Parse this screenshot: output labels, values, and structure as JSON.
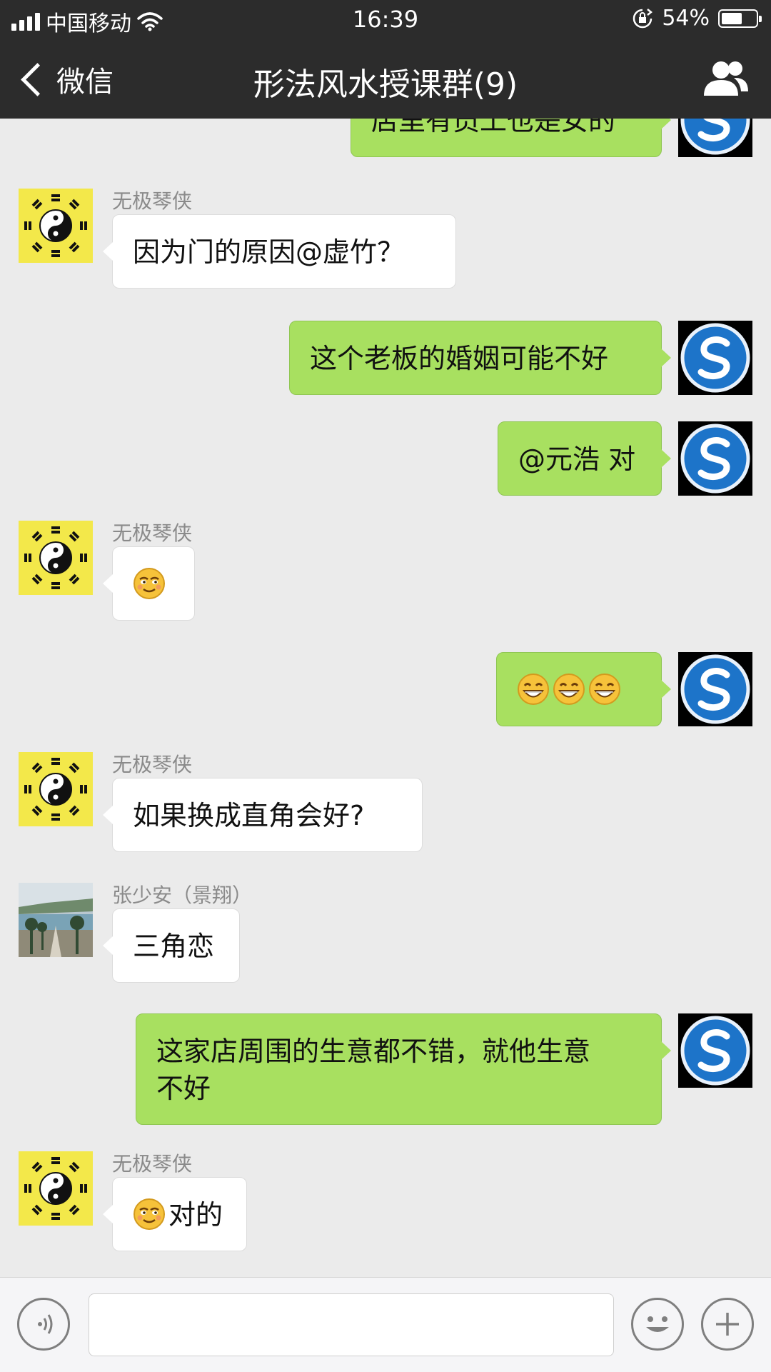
{
  "status": {
    "carrier": "中国移动",
    "time": "16:39",
    "battery": "54%",
    "battery_level": 0.54
  },
  "nav": {
    "back_label": "微信",
    "title": "形法风水授课群(9)"
  },
  "messages": [
    {
      "text": "店里有员工也是女的"
    },
    {
      "sender": "无极琴侠",
      "text": "因为门的原因@虚竹？"
    },
    {
      "text": "这个老板的婚姻可能不好"
    },
    {
      "text": "@元浩 对"
    },
    {
      "sender": "无极琴侠",
      "emoji": "smirk-emoji"
    },
    {
      "emoji": "grin-emoji"
    },
    {
      "sender": "无极琴侠",
      "text": "如果换成直角会好?"
    },
    {
      "sender": "张少安（景翔）",
      "text": "三角恋"
    },
    {
      "text_line1": "这家店周围的生意都不错，就他生意",
      "text_line2": "不好"
    },
    {
      "sender": "无极琴侠",
      "emoji": "smirk-emoji",
      "text": "对的"
    }
  ],
  "colors": {
    "nav_bg": "#2c2c2c",
    "chat_bg": "#ebebeb",
    "out_bubble": "#a8e060",
    "in_bubble": "#ffffff"
  },
  "icons": [
    "signal-icon",
    "wifi-icon",
    "lock-rotation-icon",
    "battery-icon",
    "back-chevron-icon",
    "group-members-icon",
    "voice-icon",
    "emoji-icon",
    "plus-icon"
  ]
}
